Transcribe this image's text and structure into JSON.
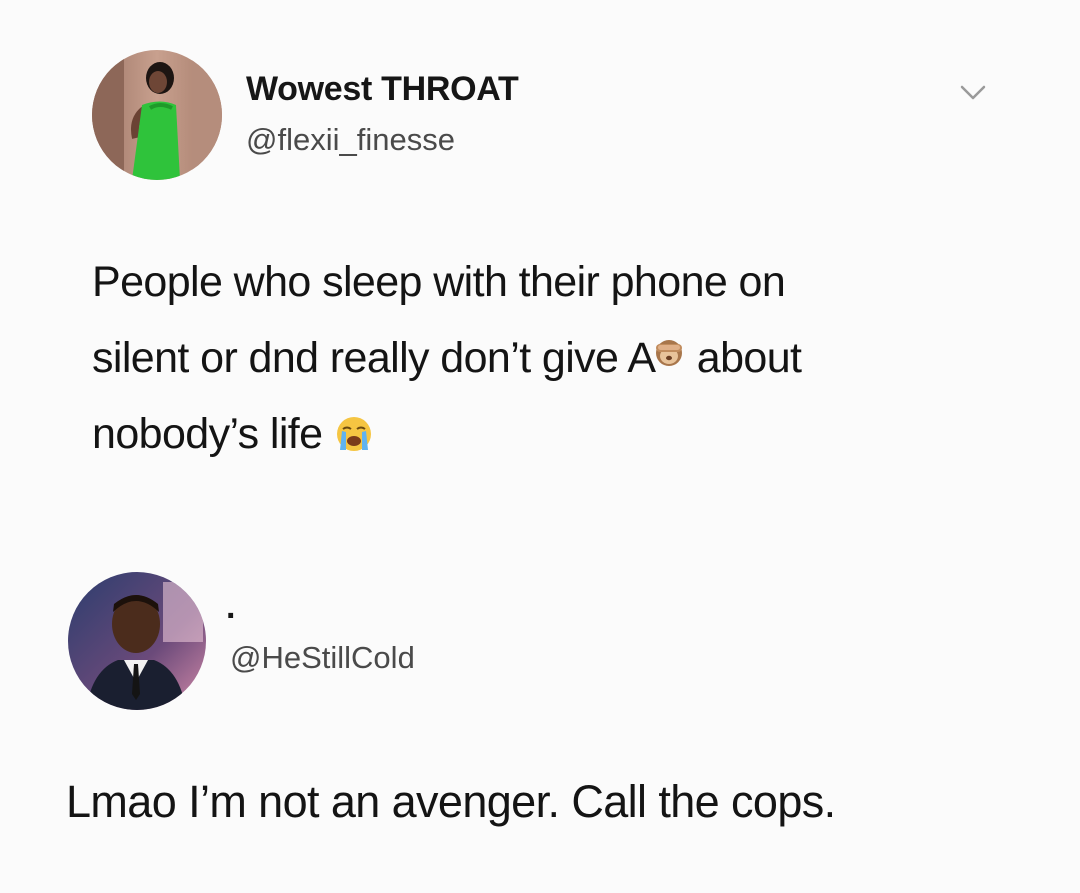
{
  "tweet": {
    "display_name": "Wowest THROAT",
    "handle": "@flexii_finesse",
    "text_line1": "People who sleep with their phone on",
    "text_line2_a": "silent or dnd really don’t give A",
    "text_line2_b": " about",
    "text_line3": "nobody’s life",
    "emoji_1": "see-no-evil-monkey-icon",
    "emoji_2": "loudly-crying-face-icon",
    "menu_icon": "chevron-down-icon"
  },
  "reply": {
    "display_name": ".",
    "handle": "@HeStillCold",
    "text": "Lmao I’m not an avenger. Call the cops."
  }
}
